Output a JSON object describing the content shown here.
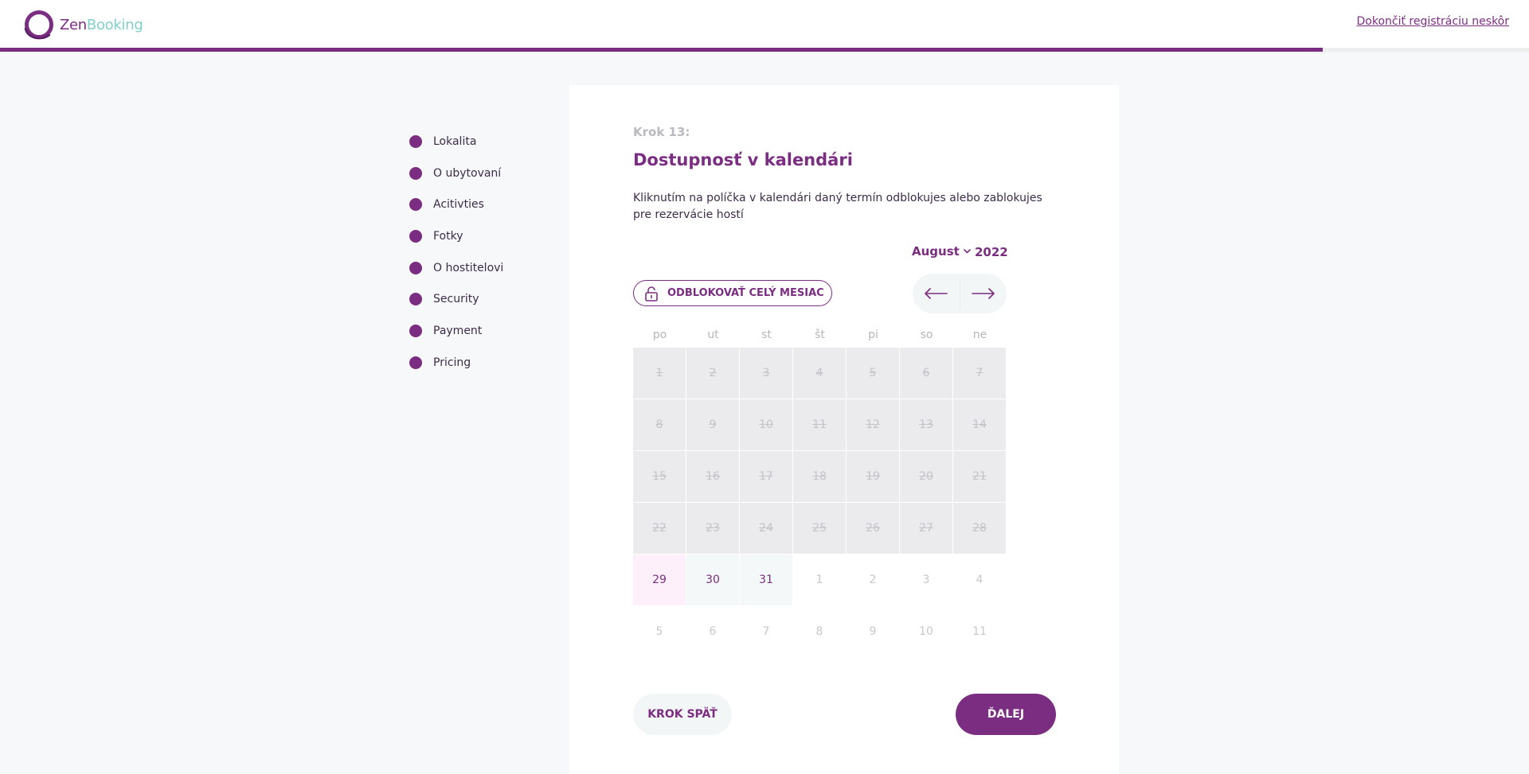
{
  "colors": {
    "accent": "#7b2d82",
    "brand_secondary": "#7fcfcb",
    "page_bg": "#f6f8f9",
    "blocked": "#ebebee"
  },
  "header": {
    "logo_zen": "Zen",
    "logo_booking": "Booking",
    "logo_icon": "zenbooking-logo-icon",
    "finish_later": "Dokončiť registráciu neskôr",
    "progress": 0.865
  },
  "sidebar": {
    "items": [
      {
        "label": "Lokalita"
      },
      {
        "label": "O ubytovaní"
      },
      {
        "label": "Acitivties"
      },
      {
        "label": "Fotky"
      },
      {
        "label": "O hostitelovi"
      },
      {
        "label": "Security"
      },
      {
        "label": "Payment"
      },
      {
        "label": "Pricing"
      }
    ]
  },
  "main": {
    "step_number": "Krok 13:",
    "title": "Dostupnosť v kalendári",
    "description": "Kliknutím na políčka v kalendári daný termín odblokujes alebo zablokujes pre rezervácie hostí",
    "month": "August",
    "year": "2022",
    "unlock_month_label": "ODBLOKOVAŤ CELÝ MESIAC",
    "unlock_icon": "unlock-icon",
    "prev_icon": "arrow-left-icon",
    "next_icon": "arrow-right-icon"
  },
  "calendar": {
    "weekdays": [
      "po",
      "ut",
      "st",
      "št",
      "pi",
      "so",
      "ne"
    ],
    "weeks": [
      [
        {
          "d": "1",
          "s": "blocked"
        },
        {
          "d": "2",
          "s": "blocked"
        },
        {
          "d": "3",
          "s": "blocked"
        },
        {
          "d": "4",
          "s": "blocked"
        },
        {
          "d": "5",
          "s": "blocked"
        },
        {
          "d": "6",
          "s": "blocked"
        },
        {
          "d": "7",
          "s": "blocked"
        }
      ],
      [
        {
          "d": "8",
          "s": "blocked"
        },
        {
          "d": "9",
          "s": "blocked"
        },
        {
          "d": "10",
          "s": "blocked"
        },
        {
          "d": "11",
          "s": "blocked"
        },
        {
          "d": "12",
          "s": "blocked"
        },
        {
          "d": "13",
          "s": "blocked"
        },
        {
          "d": "14",
          "s": "blocked"
        }
      ],
      [
        {
          "d": "15",
          "s": "blocked"
        },
        {
          "d": "16",
          "s": "blocked"
        },
        {
          "d": "17",
          "s": "blocked"
        },
        {
          "d": "18",
          "s": "blocked"
        },
        {
          "d": "19",
          "s": "blocked"
        },
        {
          "d": "20",
          "s": "blocked"
        },
        {
          "d": "21",
          "s": "blocked"
        }
      ],
      [
        {
          "d": "22",
          "s": "blocked"
        },
        {
          "d": "23",
          "s": "blocked"
        },
        {
          "d": "24",
          "s": "blocked"
        },
        {
          "d": "25",
          "s": "blocked"
        },
        {
          "d": "26",
          "s": "blocked"
        },
        {
          "d": "27",
          "s": "blocked"
        },
        {
          "d": "28",
          "s": "blocked"
        }
      ],
      [
        {
          "d": "29",
          "s": "today"
        },
        {
          "d": "30",
          "s": "open"
        },
        {
          "d": "31",
          "s": "open"
        },
        {
          "d": "1",
          "s": "other"
        },
        {
          "d": "2",
          "s": "other"
        },
        {
          "d": "3",
          "s": "other"
        },
        {
          "d": "4",
          "s": "other"
        }
      ],
      [
        {
          "d": "5",
          "s": "other"
        },
        {
          "d": "6",
          "s": "other"
        },
        {
          "d": "7",
          "s": "other"
        },
        {
          "d": "8",
          "s": "other"
        },
        {
          "d": "9",
          "s": "other"
        },
        {
          "d": "10",
          "s": "other"
        },
        {
          "d": "11",
          "s": "other"
        }
      ]
    ]
  },
  "footer": {
    "back_label": "KROK SPÄŤ",
    "next_label": "ĎALEJ"
  }
}
